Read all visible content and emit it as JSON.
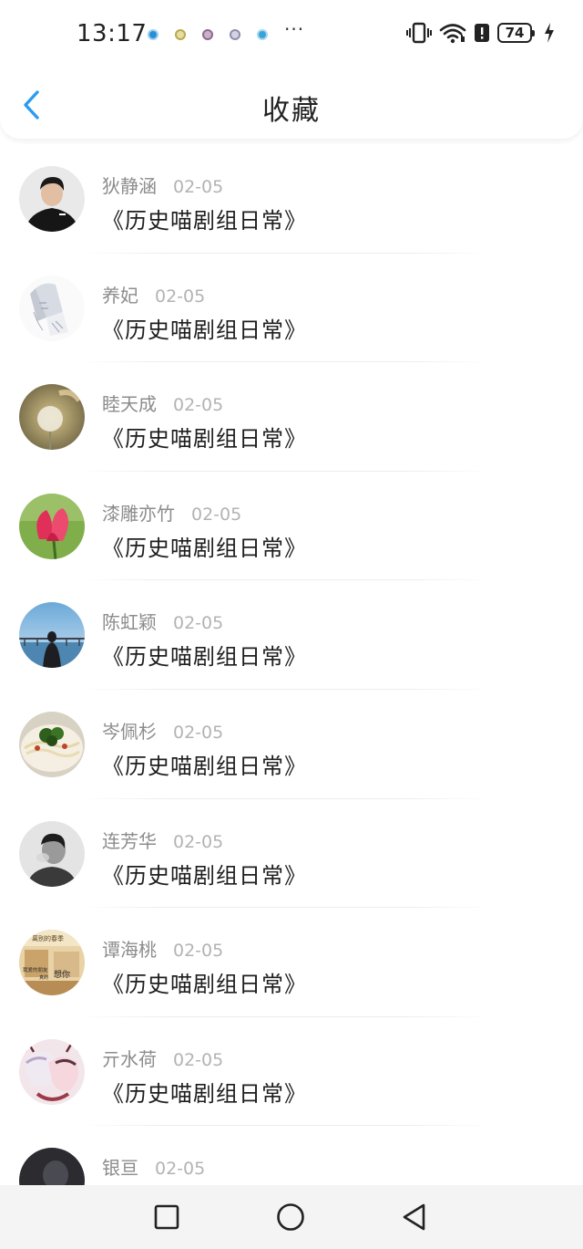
{
  "status_bar": {
    "time": "13:17",
    "more": "···",
    "battery": "74",
    "notification_colors": [
      "#2b8fd6",
      "#d6c45a",
      "#b07fb0",
      "#a8a8c8",
      "#3aa3d8"
    ]
  },
  "header": {
    "title": "收藏",
    "accent_color": "#2a9cf0"
  },
  "favorites": [
    {
      "name": "狄静涵",
      "date": "02-05",
      "title": "《历史喵剧组日常》",
      "avatar": "person-photo"
    },
    {
      "name": "养妃",
      "date": "02-05",
      "title": "《历史喵剧组日常》",
      "avatar": "sketch-drawing"
    },
    {
      "name": "睦天成",
      "date": "02-05",
      "title": "《历史喵剧组日常》",
      "avatar": "dandelion-photo"
    },
    {
      "name": "漆雕亦竹",
      "date": "02-05",
      "title": "《历史喵剧组日常》",
      "avatar": "tulip-photo"
    },
    {
      "name": "陈虹颖",
      "date": "02-05",
      "title": "《历史喵剧组日常》",
      "avatar": "sea-photo"
    },
    {
      "name": "岑佩杉",
      "date": "02-05",
      "title": "《历史喵剧组日常》",
      "avatar": "noodles-photo"
    },
    {
      "name": "连芳华",
      "date": "02-05",
      "title": "《历史喵剧组日常》",
      "avatar": "bw-portrait"
    },
    {
      "name": "谭海桃",
      "date": "02-05",
      "title": "《历史喵剧组日常》",
      "avatar": "poster-image"
    },
    {
      "name": "亓水荷",
      "date": "02-05",
      "title": "《历史喵剧组日常》",
      "avatar": "anime-image"
    },
    {
      "name": "银亘",
      "date": "02-05",
      "title": "",
      "avatar": "dark-photo"
    }
  ],
  "avatar_text": {
    "poster_top": "离别的春季",
    "poster_left": "我爱的朋友",
    "poster_mid": "想你",
    "poster_bottom": "真的"
  }
}
